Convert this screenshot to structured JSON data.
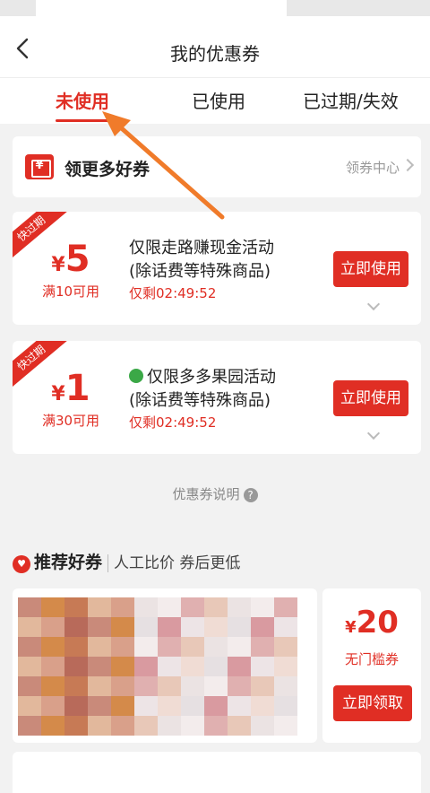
{
  "nav": {
    "title": "我的优惠券",
    "back_icon": "chevron-left-icon"
  },
  "tabs": [
    {
      "label": "未使用",
      "active": true
    },
    {
      "label": "已使用",
      "active": false
    },
    {
      "label": "已过期/失效",
      "active": false
    }
  ],
  "collect": {
    "icon_char": "¥",
    "label": "领更多好券",
    "link": "领券中心"
  },
  "coupons": [
    {
      "badge": "快过期",
      "currency": "¥",
      "amount": "5",
      "min_spend": "满10可用",
      "desc_line1": "仅限走路赚现金活动",
      "desc_line2": "(除话费等特殊商品)",
      "remaining": "仅剩02:49:52",
      "button": "立即使用"
    },
    {
      "badge": "快过期",
      "currency": "¥",
      "amount": "1",
      "min_spend": "满30可用",
      "desc_line1": "仅限多多果园活动",
      "desc_line2": "(除话费等特殊商品)",
      "remaining": "仅剩02:49:52",
      "button": "立即使用"
    }
  ],
  "explain": {
    "label": "优惠券说明",
    "help_char": "?"
  },
  "recommend": {
    "title": "推荐好券",
    "subtitle": "人工比价 券后更低",
    "item": {
      "currency": "¥",
      "amount": "20",
      "condition": "无门槛券",
      "button": "立即领取"
    }
  },
  "colors": {
    "accent": "#e02e24",
    "arrow": "#f07b2a"
  }
}
